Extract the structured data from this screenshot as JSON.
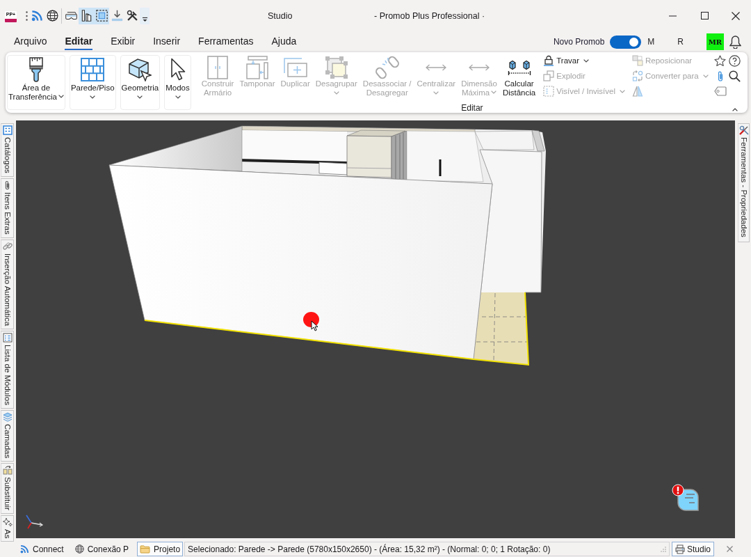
{
  "window": {
    "logo_text": "PP+",
    "title": "Studio",
    "app_title": "- Promob Plus Professional ·"
  },
  "quick_access": [
    {
      "kind": "feed",
      "on": false
    },
    {
      "kind": "globe",
      "on": false
    },
    {
      "kind": "goggles",
      "on": false
    },
    {
      "kind": "walls",
      "on": true
    },
    {
      "kind": "frame",
      "on": true
    },
    {
      "kind": "download",
      "on": false
    },
    {
      "kind": "tools",
      "on": false
    }
  ],
  "menu": [
    {
      "label": "Arquivo",
      "selected": false
    },
    {
      "label": "Editar",
      "selected": true
    },
    {
      "label": "Exibir",
      "selected": false
    },
    {
      "label": "Inserir",
      "selected": false
    },
    {
      "label": "Ferramentas",
      "selected": false
    },
    {
      "label": "Ajuda",
      "selected": false
    }
  ],
  "account": {
    "toggle_label": "Novo Promob",
    "toggle_on": true,
    "name_fragments": [
      "M",
      "R"
    ],
    "avatar_initials": "MR"
  },
  "ribbon": {
    "panels": [
      {
        "kind": "clipboard",
        "lines": [
          "Área de",
          "Transferência"
        ],
        "dropdown": true
      },
      {
        "kind": "wall-floor",
        "lines": [
          "Parede/Piso"
        ],
        "dropdown": true
      },
      {
        "kind": "geometry",
        "lines": [
          "Geometria"
        ],
        "dropdown": true
      },
      {
        "kind": "modes",
        "lines": [
          "Modos"
        ],
        "dropdown": true
      }
    ],
    "edit_group": {
      "label": "Editar",
      "large_buttons": [
        {
          "kind": "build-cabinet",
          "lines": [
            "Construir",
            "Armário"
          ],
          "disabled": true,
          "dropdown": false
        },
        {
          "kind": "cover",
          "lines": [
            "Tamponar"
          ],
          "disabled": true,
          "dropdown": false
        },
        {
          "kind": "duplicate",
          "lines": [
            "Duplicar"
          ],
          "disabled": true,
          "dropdown": false
        },
        {
          "kind": "ungroup",
          "lines": [
            "Desagrupar"
          ],
          "disabled": true,
          "dropdown": true
        },
        {
          "kind": "dissociate",
          "lines": [
            "Desassociar /",
            "Desagregar"
          ],
          "disabled": true,
          "dropdown": false
        },
        {
          "kind": "center",
          "lines": [
            "Centralizar"
          ],
          "disabled": true,
          "dropdown": true
        },
        {
          "kind": "max-dimension",
          "lines": [
            "Dimensão",
            "Máxima"
          ],
          "disabled": true,
          "dropdown": true
        },
        {
          "kind": "measure-distance",
          "lines": [
            "Calcular",
            "Distância"
          ],
          "disabled": false,
          "dropdown": false
        }
      ],
      "small_buttons": [
        {
          "kind": "lock",
          "label": "Travar",
          "disabled": false,
          "dropdown": true
        },
        {
          "kind": "explode",
          "label": "Explodir",
          "disabled": true,
          "dropdown": false
        },
        {
          "kind": "visibility",
          "label": "Visível / Invisível",
          "disabled": true,
          "dropdown": true
        },
        {
          "kind": "reposition",
          "label": "Reposicionar",
          "disabled": true,
          "dropdown": false
        },
        {
          "kind": "convert",
          "label": "Converter para",
          "disabled": true,
          "dropdown": true
        },
        {
          "kind": "mirror",
          "disabled": true,
          "dropdown": false
        }
      ],
      "icon_buttons": [
        {
          "kind": "favorite"
        },
        {
          "kind": "help"
        },
        {
          "kind": "attach"
        },
        {
          "kind": "search"
        },
        {
          "kind": "tag"
        }
      ]
    }
  },
  "left_tabs": [
    {
      "kind": "catalogs",
      "label": "Catálogos"
    },
    {
      "kind": "extras",
      "label": "Itens Extras"
    },
    {
      "kind": "auto-insert",
      "label": "Inserção Automática"
    },
    {
      "kind": "module-list",
      "label": "Lista de Módulos"
    },
    {
      "kind": "layers",
      "label": "Camadas"
    },
    {
      "kind": "replace",
      "label": "Substituir"
    },
    {
      "kind": "assistant",
      "label": "As"
    }
  ],
  "right_tabs": [
    {
      "kind": "tools",
      "label": "Ferramentas - Propriedades"
    }
  ],
  "status_bar": {
    "items": [
      {
        "kind": "feed",
        "label": "Connect",
        "selected": false
      },
      {
        "kind": "globe",
        "label": "Conexão P",
        "selected": false
      },
      {
        "kind": "folder",
        "label": "Projeto",
        "selected": true
      }
    ],
    "message": "Selecionado: Parede -> Parede (5780x150x2650) - (Área: 15,32 m²) - (Normal: 0; 0; 1 Rotação: 0)",
    "document_tab": "Studio"
  }
}
